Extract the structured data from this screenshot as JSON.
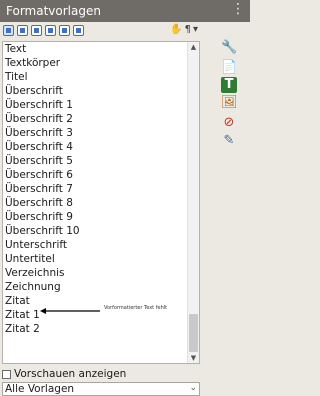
{
  "window": {
    "title": "Formatvorlagen"
  },
  "toolbar": {
    "style_categories": [
      "paragraph-styles",
      "character-styles",
      "frame-styles",
      "page-styles",
      "list-styles",
      "table-styles"
    ],
    "right_controls": [
      "fill-format-icon",
      "new-style-icon",
      "dropdown"
    ]
  },
  "styles": [
    "Text",
    "Textkörper",
    "Titel",
    "Überschrift",
    "Überschrift 1",
    "Überschrift 2",
    "Überschrift 3",
    "Überschrift 4",
    "Überschrift 5",
    "Überschrift 6",
    "Überschrift 7",
    "Überschrift 8",
    "Überschrift 9",
    "Überschrift 10",
    "Unterschrift",
    "Untertitel",
    "Verzeichnis",
    "Zeichnung",
    "Zitat",
    "Zitat 1",
    "Zitat 2"
  ],
  "annotation": {
    "text": "Vorformatierter Text fehlt"
  },
  "preview": {
    "label": "Vorschauen anzeigen",
    "checked": false
  },
  "filter": {
    "selected": "Alle Vorlagen"
  },
  "sidebar": {
    "icons": [
      "properties-icon",
      "page-icon",
      "styles-icon",
      "gallery-icon",
      "navigator-icon",
      "manage-changes-icon"
    ]
  }
}
